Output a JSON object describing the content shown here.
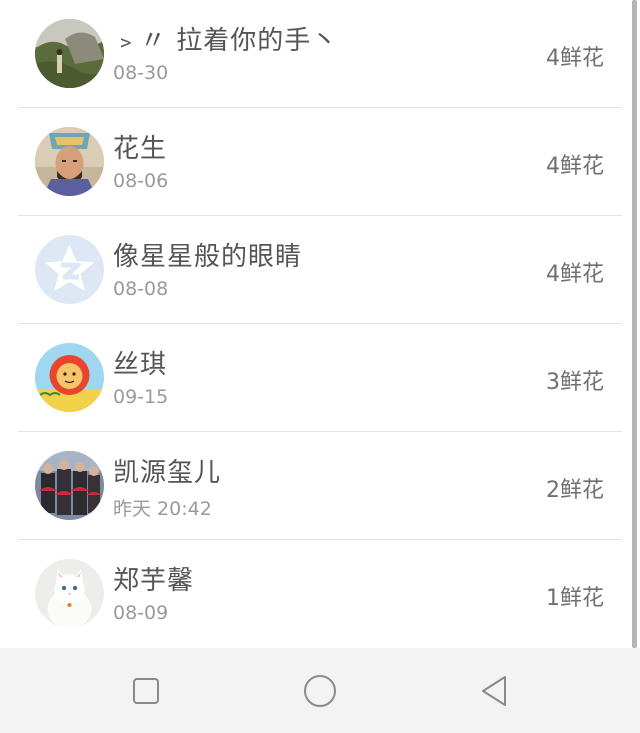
{
  "list": {
    "items": [
      {
        "name": "﹥〃 拉着你的手丶",
        "date": "08-30",
        "flowers": "4鲜花",
        "avatar_icon": "landscape-avatar"
      },
      {
        "name": "花生",
        "date": "08-06",
        "flowers": "4鲜花",
        "avatar_icon": "warrior-avatar"
      },
      {
        "name": "像星星般的眼睛",
        "date": "08-08",
        "flowers": "4鲜花",
        "avatar_icon": "qzone-star-avatar"
      },
      {
        "name": "丝琪",
        "date": "09-15",
        "flowers": "3鲜花",
        "avatar_icon": "cartoon-lion-avatar"
      },
      {
        "name": "凯源玺儿",
        "date": "昨天 20:42",
        "flowers": "2鲜花",
        "avatar_icon": "group-photo-avatar"
      },
      {
        "name": "郑芋馨",
        "date": "08-09",
        "flowers": "1鲜花",
        "avatar_icon": "white-cat-avatar"
      }
    ]
  },
  "navbar": {
    "buttons": [
      "recent-apps-icon",
      "home-icon",
      "back-icon"
    ]
  }
}
